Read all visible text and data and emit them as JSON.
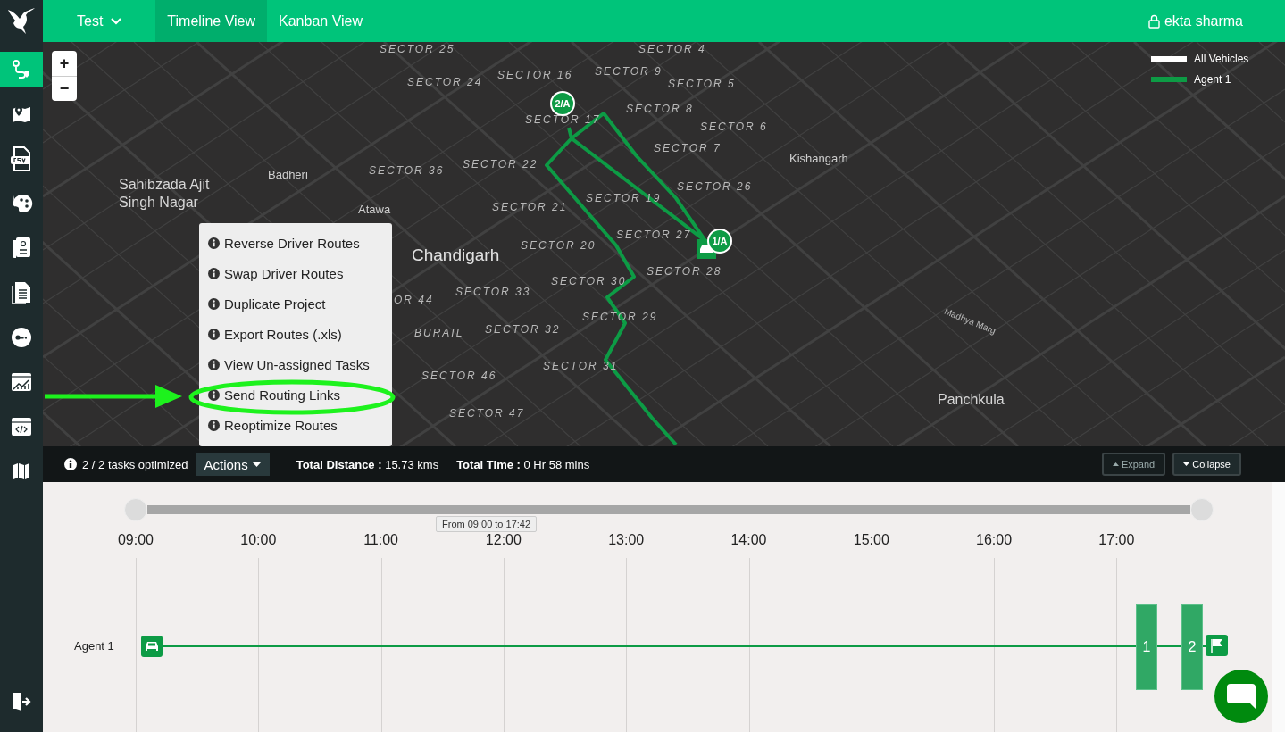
{
  "sidebar": {
    "items": [
      {
        "selected": true
      },
      {
        "selected": false
      },
      {
        "selected": false
      },
      {
        "selected": false
      },
      {
        "selected": false
      },
      {
        "selected": false
      },
      {
        "selected": false
      },
      {
        "selected": false
      },
      {
        "selected": false
      },
      {
        "selected": false
      }
    ]
  },
  "top_bar": {
    "project": {
      "label": "Test"
    },
    "tabs": [
      {
        "label": "Timeline View",
        "selected": true
      },
      {
        "label": "Kanban View",
        "selected": false
      }
    ],
    "user": "ekta sharma"
  },
  "map": {
    "zoom_in": "+",
    "zoom_out": "−",
    "legend": [
      {
        "label": "All Vehicles",
        "color": "#ffffff"
      },
      {
        "label": "Agent 1",
        "color": "#0d9b45"
      }
    ],
    "labels": [
      {
        "text": "SECTOR 25",
        "kind": "sector"
      },
      {
        "text": "SECTOR 4",
        "kind": "sector"
      },
      {
        "text": "SECTOR 16",
        "kind": "sector"
      },
      {
        "text": "SECTOR 9",
        "kind": "sector"
      },
      {
        "text": "SECTOR 24",
        "kind": "sector"
      },
      {
        "text": "SECTOR 5",
        "kind": "sector"
      },
      {
        "text": "SECTOR 8",
        "kind": "sector"
      },
      {
        "text": "SECTOR 17",
        "kind": "sector"
      },
      {
        "text": "SECTOR 6",
        "kind": "sector"
      },
      {
        "text": "SECTOR 7",
        "kind": "sector"
      },
      {
        "text": "Kishangarh",
        "kind": "place"
      },
      {
        "text": "SECTOR 36",
        "kind": "sector"
      },
      {
        "text": "SECTOR 22",
        "kind": "sector"
      },
      {
        "text": "Badheri",
        "kind": "place"
      },
      {
        "text": "Sahibzada Ajit\nSingh Nagar",
        "kind": "town"
      },
      {
        "text": "SECTOR 19",
        "kind": "sector"
      },
      {
        "text": "SECTOR 26",
        "kind": "sector"
      },
      {
        "text": "Atawa",
        "kind": "place"
      },
      {
        "text": "SECTOR 21",
        "kind": "sector"
      },
      {
        "text": "SECTOR 27",
        "kind": "sector"
      },
      {
        "text": "SECTOR 20",
        "kind": "sector"
      },
      {
        "text": "Chandigarh",
        "kind": "city"
      },
      {
        "text": "SECTOR 28",
        "kind": "sector"
      },
      {
        "text": "SECTOR 30",
        "kind": "sector"
      },
      {
        "text": "SECTOR 33",
        "kind": "sector"
      },
      {
        "text": "OR 44",
        "kind": "sector"
      },
      {
        "text": "SECTOR 29",
        "kind": "sector"
      },
      {
        "text": "Madhya Marg",
        "kind": "road"
      },
      {
        "text": "BURAIL",
        "kind": "sector"
      },
      {
        "text": "SECTOR 32",
        "kind": "sector"
      },
      {
        "text": "SECTOR 31",
        "kind": "sector"
      },
      {
        "text": "SECTOR 46",
        "kind": "sector"
      },
      {
        "text": "Panchkula",
        "kind": "town"
      },
      {
        "text": "SECTOR 47",
        "kind": "sector"
      }
    ],
    "pins": [
      {
        "label": "2/A"
      },
      {
        "label": "1/A"
      }
    ],
    "actions_menu": {
      "items": [
        {
          "label": "Reverse Driver Routes",
          "annotated": false
        },
        {
          "label": "Swap Driver Routes",
          "annotated": false
        },
        {
          "label": "Duplicate Project",
          "annotated": false
        },
        {
          "label": "Export Routes (.xls)",
          "annotated": false
        },
        {
          "label": "View Un-assigned Tasks",
          "annotated": false
        },
        {
          "label": "Send Routing Links",
          "annotated": true
        },
        {
          "label": "Reoptimize Routes",
          "annotated": false
        }
      ]
    }
  },
  "summary_bar": {
    "tasks_optimized": "2 / 2 tasks optimized",
    "actions_button": {
      "label": "Actions",
      "expanded": true
    },
    "total_distance": "**Total Distance :** 15.73 kms",
    "total_time": "**Total Time :** 0 Hr 58 mins",
    "buttons": [
      {
        "label": "Expand",
        "disabled": true
      },
      {
        "label": "Collapse",
        "disabled": false
      }
    ]
  },
  "timeline": {
    "range_slider": {
      "level": 1
    },
    "range_tooltip": "From 09:00 to 17:42",
    "hours": [
      "09:00",
      "10:00",
      "11:00",
      "12:00",
      "13:00",
      "14:00",
      "15:00",
      "16:00",
      "17:00"
    ],
    "rows": [
      {
        "label": "Agent 1",
        "tasks": [
          {
            "label": "1"
          },
          {
            "label": "2"
          }
        ]
      }
    ]
  }
}
